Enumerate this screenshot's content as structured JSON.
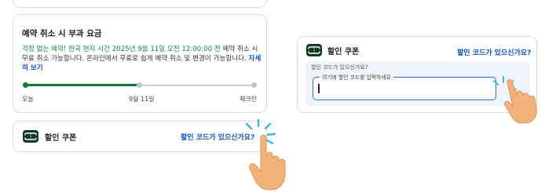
{
  "policy": {
    "title": "예약 취소 시 부과 요금",
    "highlight": "걱정 없는 예약! 한국 현지 시간 2025년 9월 11일 오전 12:00:00 전",
    "body": " 예약 취소 시 무료 취소 가능합니다. 온라인에서 무료로 쉽게 예약 취소 및 변경이 가능합니다. ",
    "link": "자세히 보기",
    "timeline": {
      "labels": [
        "오늘",
        "9월 11일",
        "체크인"
      ],
      "progress": 0.5
    }
  },
  "coupon": {
    "title": "할인 쿠폰",
    "link": "할인 코드가 있으신가요?",
    "code_prompt": "할인 코드가 있으신가요?",
    "input_label": "여기에 할인 코드를 입력하세요",
    "input_value": ""
  },
  "colors": {
    "accent_green": "#0c8a3e",
    "link_blue": "#0a58ca",
    "input_border": "#2b6fd6",
    "hand": "#f2b27a"
  },
  "icons": {
    "coupon": "ticket-icon",
    "tap": "tap-hand-icon"
  }
}
